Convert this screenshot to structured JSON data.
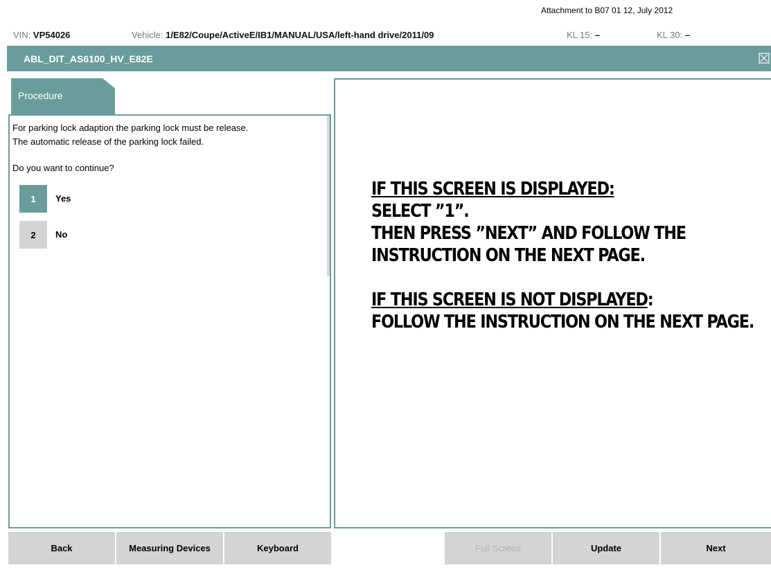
{
  "attachment": "Attachment to B07 01 12, July 2012",
  "info": {
    "vin_label": "VIN:",
    "vin_value": "VP54026",
    "vehicle_label": "Vehicle:",
    "vehicle_value": "1/E82/Coupe/ActiveE/IB1/MANUAL/USA/left-hand drive/2011/09",
    "kl15_label": "KL 15:",
    "kl15_value": "–",
    "kl30_label": "KL 30:",
    "kl30_value": "–"
  },
  "title": "ABL_DIT_AS6100_HV_E82E",
  "tab": {
    "label": "Procedure"
  },
  "procedure": {
    "line1": "For parking lock adaption the parking lock must be release.",
    "line2": "The automatic release of the parking lock failed.",
    "question": "Do you want to continue?",
    "options": [
      {
        "number": "1",
        "label": "Yes"
      },
      {
        "number": "2",
        "label": "No"
      }
    ]
  },
  "instructions": {
    "a_heading": "IF THIS SCREEN IS DISPLAYED:",
    "a_line1": "SELECT ”1”.",
    "a_line2": "THEN PRESS ”NEXT” AND FOLLOW THE INSTRUCTION ON THE NEXT PAGE.",
    "b_heading": "IF THIS SCREEN IS NOT DISPLAYED",
    "b_colon": ":",
    "b_line1": "FOLLOW THE INSTRUCTION ON THE NEXT PAGE."
  },
  "buttons": {
    "back": "Back",
    "measuring": "Measuring Devices",
    "keyboard": "Keyboard",
    "full_screen": "Full Screen",
    "update": "Update",
    "next": "Next"
  },
  "colors": {
    "accent": "#6a9c9c",
    "button": "#d4d4d4"
  }
}
